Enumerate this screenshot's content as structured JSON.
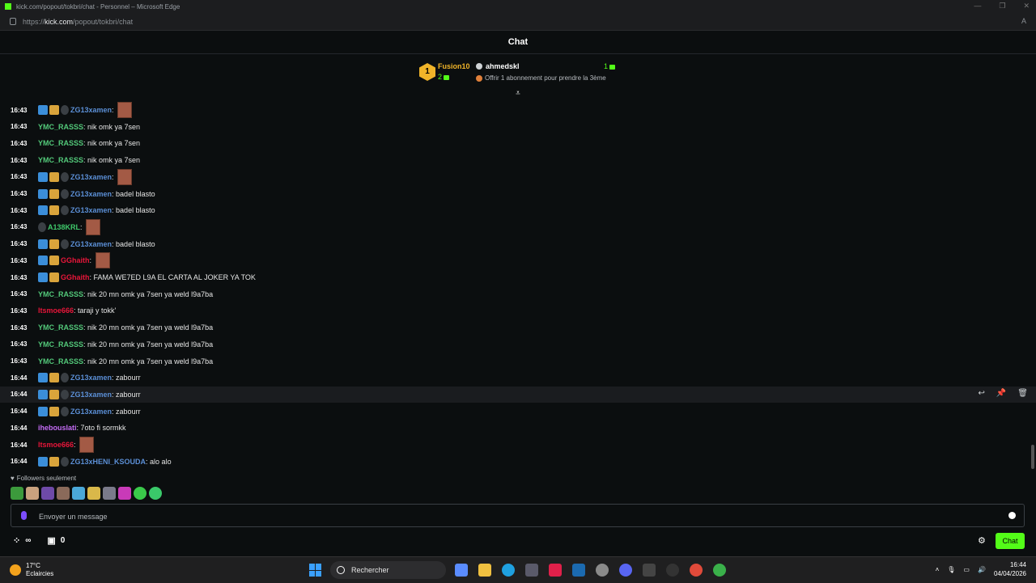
{
  "browser": {
    "window_title": "kick.com/popout/tokbri/chat - Personnel – Microsoft Edge",
    "url_prefix": "https://",
    "url_host": "kick.com",
    "url_path": "/popout/tokbri/chat"
  },
  "header": {
    "title": "Chat"
  },
  "leaderboard": {
    "first_rank": "1",
    "first_name": "Fusion10",
    "first_count": "2",
    "second_name": "ahmedskl",
    "second_count": "1",
    "offer_text": "Offrir 1 abonnement pour prendre la 3ème"
  },
  "colors": {
    "kick_green": "#53fc18",
    "zg_blue": "#5b8fd6",
    "ymc_green": "#53c97a",
    "red_user": "#e8163a",
    "purple_user": "#c46cf5",
    "a138_green": "#3fc96b"
  },
  "messages": [
    {
      "time": "16:43",
      "user": "ZG13xamen",
      "text": "",
      "emote": true
    },
    {
      "time": "16:43",
      "user": "YMC_RASSS",
      "text": "nik omk ya 7sen"
    },
    {
      "time": "16:43",
      "user": "YMC_RASSS",
      "text": "nik omk ya 7sen"
    },
    {
      "time": "16:43",
      "user": "YMC_RASSS",
      "text": "nik omk ya 7sen"
    },
    {
      "time": "16:43",
      "user": "ZG13xamen",
      "text": "",
      "emote": true
    },
    {
      "time": "16:43",
      "user": "ZG13xamen",
      "text": "badel blasto"
    },
    {
      "time": "16:43",
      "user": "ZG13xamen",
      "text": "badel blasto"
    },
    {
      "time": "16:43",
      "user": "A138KRL",
      "text": "",
      "emote": true
    },
    {
      "time": "16:43",
      "user": "ZG13xamen",
      "text": "badel blasto"
    },
    {
      "time": "16:43",
      "user": "GGhaith",
      "text": "",
      "emote": true
    },
    {
      "time": "16:43",
      "user": "GGhaith",
      "text": "FAMA WE7ED L9A EL CARTA AL JOKER YA TOK"
    },
    {
      "time": "16:43",
      "user": "YMC_RASSS",
      "text": "nik 20 mn omk ya 7sen ya weld l9a7ba"
    },
    {
      "time": "16:43",
      "user": "ltsmoe666",
      "text": "taraji y tokk'"
    },
    {
      "time": "16:43",
      "user": "YMC_RASSS",
      "text": "nik 20 mn omk ya 7sen ya weld l9a7ba"
    },
    {
      "time": "16:43",
      "user": "YMC_RASSS",
      "text": "nik 20 mn omk ya 7sen ya weld l9a7ba"
    },
    {
      "time": "16:43",
      "user": "YMC_RASSS",
      "text": "nik 20 mn omk ya 7sen ya weld l9a7ba"
    },
    {
      "time": "16:44",
      "user": "ZG13xamen",
      "text": "zabourr"
    },
    {
      "time": "16:44",
      "user": "ZG13xamen",
      "text": "zabourr"
    },
    {
      "time": "16:44",
      "user": "ZG13xamen",
      "text": "zabourr"
    },
    {
      "time": "16:44",
      "user": "ihebouslati",
      "text": "7oto fi sormkk"
    },
    {
      "time": "16:44",
      "user": "ltsmoe666",
      "text": "",
      "emote": true
    },
    {
      "time": "16:44",
      "user": "ZG13xHENI_KSOUDA",
      "text": "alo alo"
    }
  ],
  "chat": {
    "followers_only": "Followers seulement",
    "input_placeholder": "Envoyer un message",
    "infinity": "∞",
    "kick_count": "0",
    "send_label": "Chat"
  },
  "taskbar": {
    "temp": "17°C",
    "weather": "Eclaircies",
    "search_label": "Rechercher",
    "time": "16:44",
    "date": "04/04/2026"
  }
}
